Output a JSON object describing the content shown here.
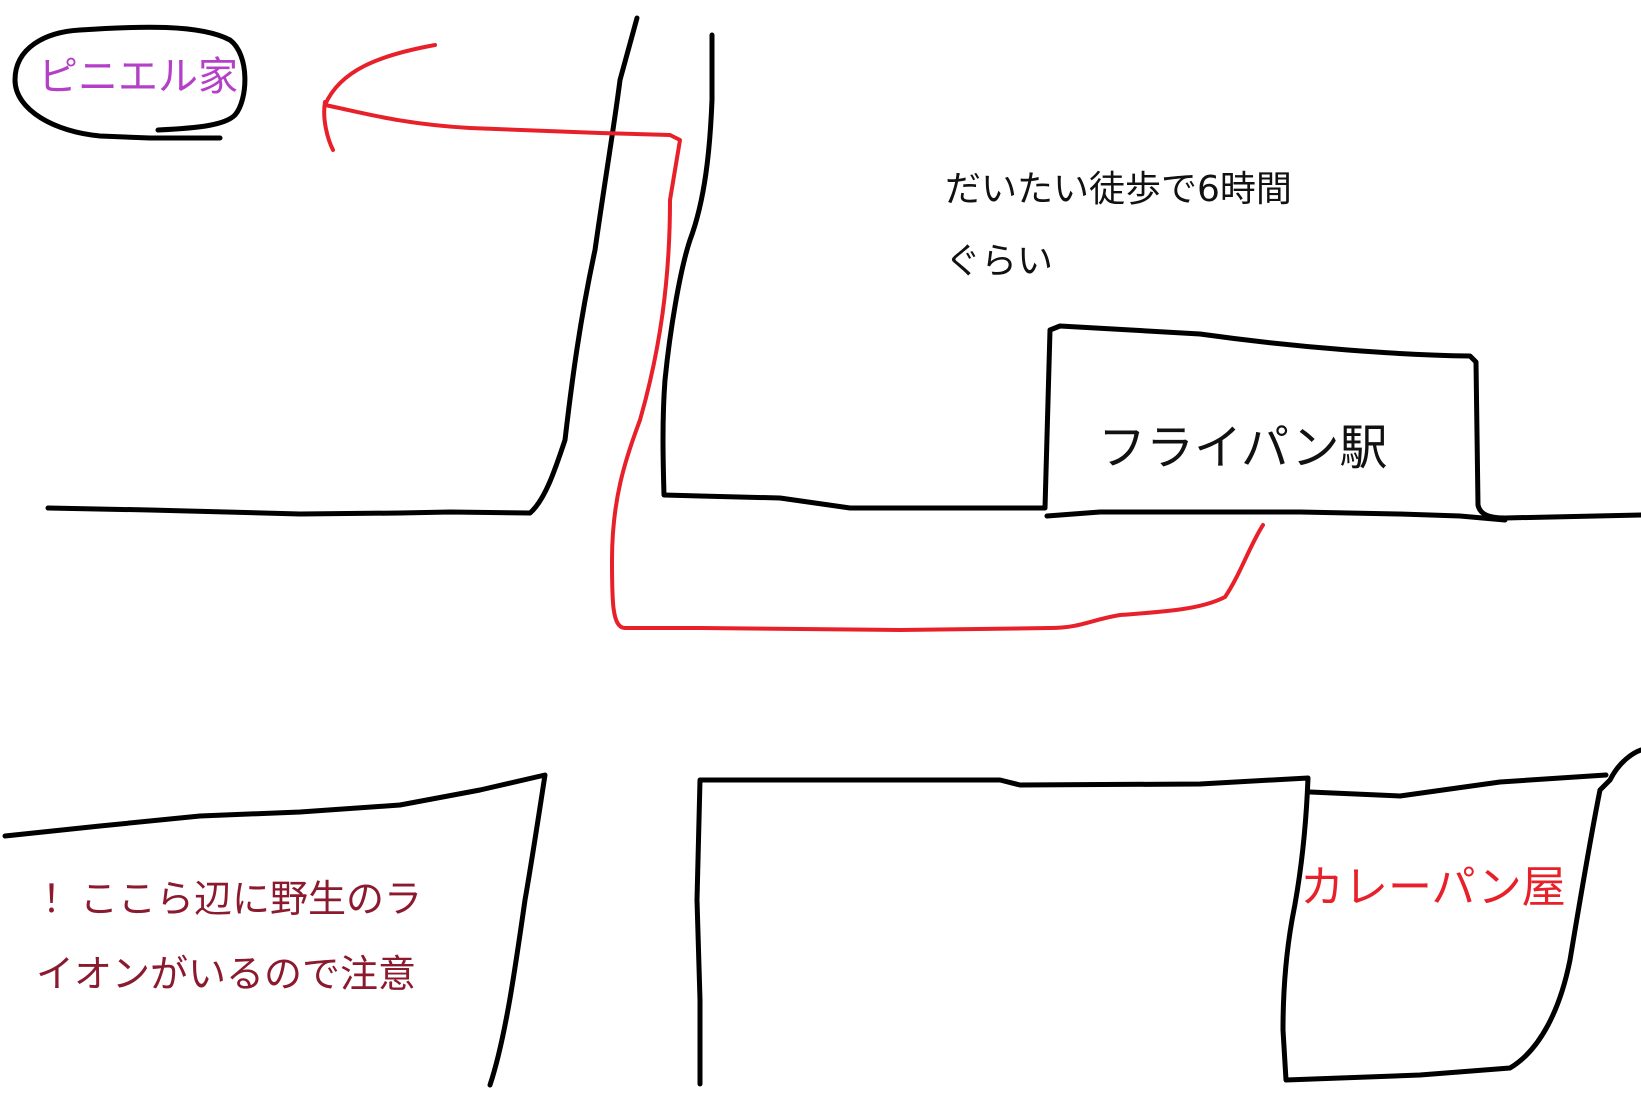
{
  "colors": {
    "road": "#000000",
    "route": "#e8202a",
    "home_label": "#b440c8",
    "curry_label": "#e8202a",
    "warning_label": "#8b1a2e",
    "text": "#111111"
  },
  "labels": {
    "home": "ピニエル家",
    "travel_time_line1": "だいたい徒歩で6時間",
    "travel_time_line2": "ぐらい",
    "station": "フライパン駅",
    "curry_bread_shop": "カレーパン屋",
    "warning_line1": "！ここら辺に野生のラ",
    "warning_line2": "イオンがいるので注意"
  }
}
